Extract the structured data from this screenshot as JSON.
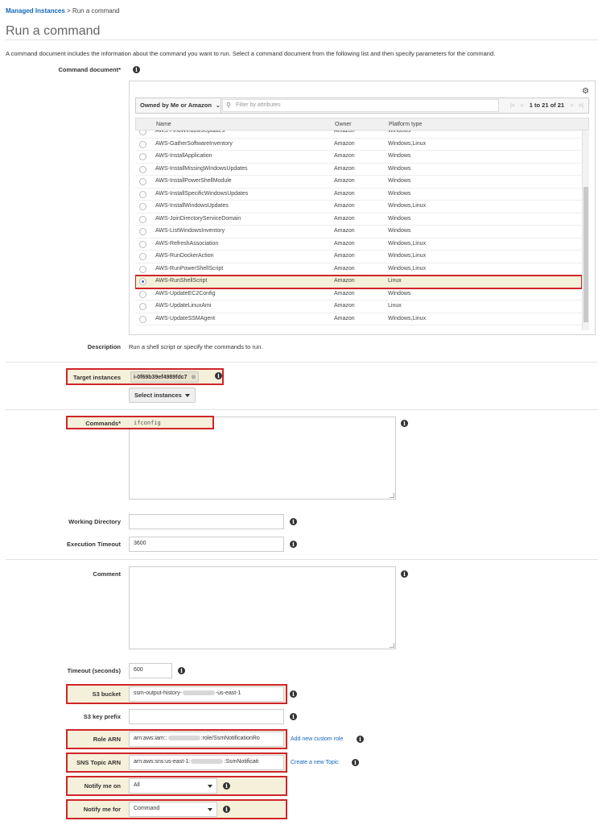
{
  "breadcrumb": {
    "parent": "Managed Instances",
    "sep": " > ",
    "current": "Run a command"
  },
  "page_title": "Run a command",
  "intro": "A command document includes the information about the command you want to run. Select a command document from the following list and then specify parameters for the command.",
  "command_document": {
    "label": "Command document*",
    "owner_filter": "Owned by Me or Amazon",
    "filter_placeholder": "Filter by attributes",
    "pagination": "1 to 21 of 21",
    "columns": [
      "Name",
      "Owner",
      "Platform type"
    ],
    "rows": [
      {
        "name": "AWS-FindWindowsUpdates",
        "owner": "Amazon",
        "platform": "Windows",
        "selected": false
      },
      {
        "name": "AWS-GatherSoftwareInventory",
        "owner": "Amazon",
        "platform": "Windows,Linux",
        "selected": false
      },
      {
        "name": "AWS-InstallApplication",
        "owner": "Amazon",
        "platform": "Windows",
        "selected": false
      },
      {
        "name": "AWS-InstallMissingWindowsUpdates",
        "owner": "Amazon",
        "platform": "Windows",
        "selected": false
      },
      {
        "name": "AWS-InstallPowerShellModule",
        "owner": "Amazon",
        "platform": "Windows",
        "selected": false
      },
      {
        "name": "AWS-InstallSpecificWindowsUpdates",
        "owner": "Amazon",
        "platform": "Windows",
        "selected": false
      },
      {
        "name": "AWS-InstallWindowsUpdates",
        "owner": "Amazon",
        "platform": "Windows,Linux",
        "selected": false
      },
      {
        "name": "AWS-JoinDirectoryServiceDomain",
        "owner": "Amazon",
        "platform": "Windows",
        "selected": false
      },
      {
        "name": "AWS-ListWindowsInventory",
        "owner": "Amazon",
        "platform": "Windows",
        "selected": false
      },
      {
        "name": "AWS-RefreshAssociation",
        "owner": "Amazon",
        "platform": "Windows,Linux",
        "selected": false
      },
      {
        "name": "AWS-RunDockerAction",
        "owner": "Amazon",
        "platform": "Windows,Linux",
        "selected": false
      },
      {
        "name": "AWS-RunPowerShellScript",
        "owner": "Amazon",
        "platform": "Windows,Linux",
        "selected": false
      },
      {
        "name": "AWS-RunShellScript",
        "owner": "Amazon",
        "platform": "Linux",
        "selected": true
      },
      {
        "name": "AWS-UpdateEC2Config",
        "owner": "Amazon",
        "platform": "Windows",
        "selected": false
      },
      {
        "name": "AWS-UpdateLinuxAmi",
        "owner": "Amazon",
        "platform": "Linux",
        "selected": false
      },
      {
        "name": "AWS-UpdateSSMAgent",
        "owner": "Amazon",
        "platform": "Windows,Linux",
        "selected": false
      }
    ]
  },
  "description": {
    "label": "Description",
    "value": "Run a shell script or specify the commands to run."
  },
  "target_instances": {
    "label": "Target instances",
    "value": "i-0f69b39ef4989fdc7",
    "button": "Select instances"
  },
  "commands": {
    "label": "Commands*",
    "value": "ifconfig"
  },
  "working_directory": {
    "label": "Working Directory",
    "value": ""
  },
  "execution_timeout": {
    "label": "Execution Timeout",
    "value": "3600"
  },
  "comment": {
    "label": "Comment",
    "value": ""
  },
  "timeout": {
    "label": "Timeout (seconds)",
    "value": "600"
  },
  "s3_bucket": {
    "label": "S3 bucket",
    "prefix": "ssm-output-history-",
    "suffix": "-us-east-1"
  },
  "s3_key_prefix": {
    "label": "S3 key prefix",
    "value": ""
  },
  "role_arn": {
    "label": "Role ARN",
    "prefix": "arn:aws:iam::",
    "suffix": ":role/SsmNotificationRo",
    "link": "Add new custom role"
  },
  "sns_topic_arn": {
    "label": "SNS Topic ARN",
    "prefix": "arn:aws:sns:us-east-1:",
    "suffix": ":SsmNotificati",
    "link": "Create a new Topic"
  },
  "notify_me_on": {
    "label": "Notify me on",
    "value": "All"
  },
  "notify_me_for": {
    "label": "Notify me for",
    "value": "Command"
  },
  "colors": {
    "accent_link": "#1166bb",
    "highlight_border": "#d0252a",
    "highlight_bg": "#f5f0d9"
  },
  "icons": [
    "info-icon",
    "gear-icon",
    "search-icon",
    "chevron-down-icon",
    "first-page-icon",
    "prev-page-icon",
    "next-page-icon",
    "last-page-icon"
  ]
}
